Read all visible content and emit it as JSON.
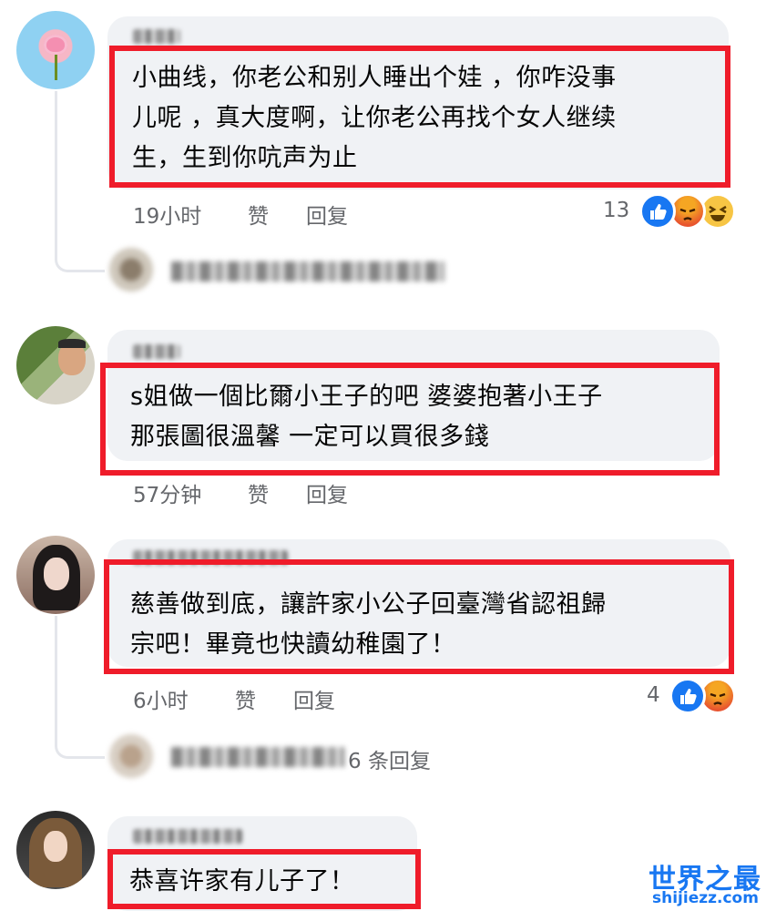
{
  "colors": {
    "highlight": "#ef1c2a",
    "bubble": "#f0f2f5",
    "meta": "#65676b",
    "like": "#1877f2"
  },
  "comments": [
    {
      "lines": [
        "小曲线，你老公和别人睡出个娃 ，你咋没事",
        "儿呢 ，真大度啊，让你老公再找个女人继续",
        "生，生到你吭声为止"
      ],
      "time": "19小时",
      "like_label": "赞",
      "reply_label": "回复",
      "reaction_count": "13",
      "reactions": [
        "like-icon",
        "angry-icon",
        "haha-icon"
      ]
    },
    {
      "lines": [
        "s姐做一個比爾小王子的吧 婆婆抱著小王子",
        "那張圖很溫馨 一定可以買很多錢"
      ],
      "time": "57分钟",
      "like_label": "赞",
      "reply_label": "回复"
    },
    {
      "lines": [
        "慈善做到底，讓許家小公子回臺灣省認祖歸",
        "宗吧！畢竟也快讀幼稚園了！"
      ],
      "time": "6小时",
      "like_label": "赞",
      "reply_label": "回复",
      "reaction_count": "4",
      "reactions": [
        "like-icon",
        "angry-icon"
      ],
      "replies_text": "6 条回复"
    },
    {
      "lines": [
        "恭喜许家有儿子了！"
      ]
    }
  ],
  "watermark": {
    "title": "世界之最",
    "url": "shijiezz.com"
  }
}
